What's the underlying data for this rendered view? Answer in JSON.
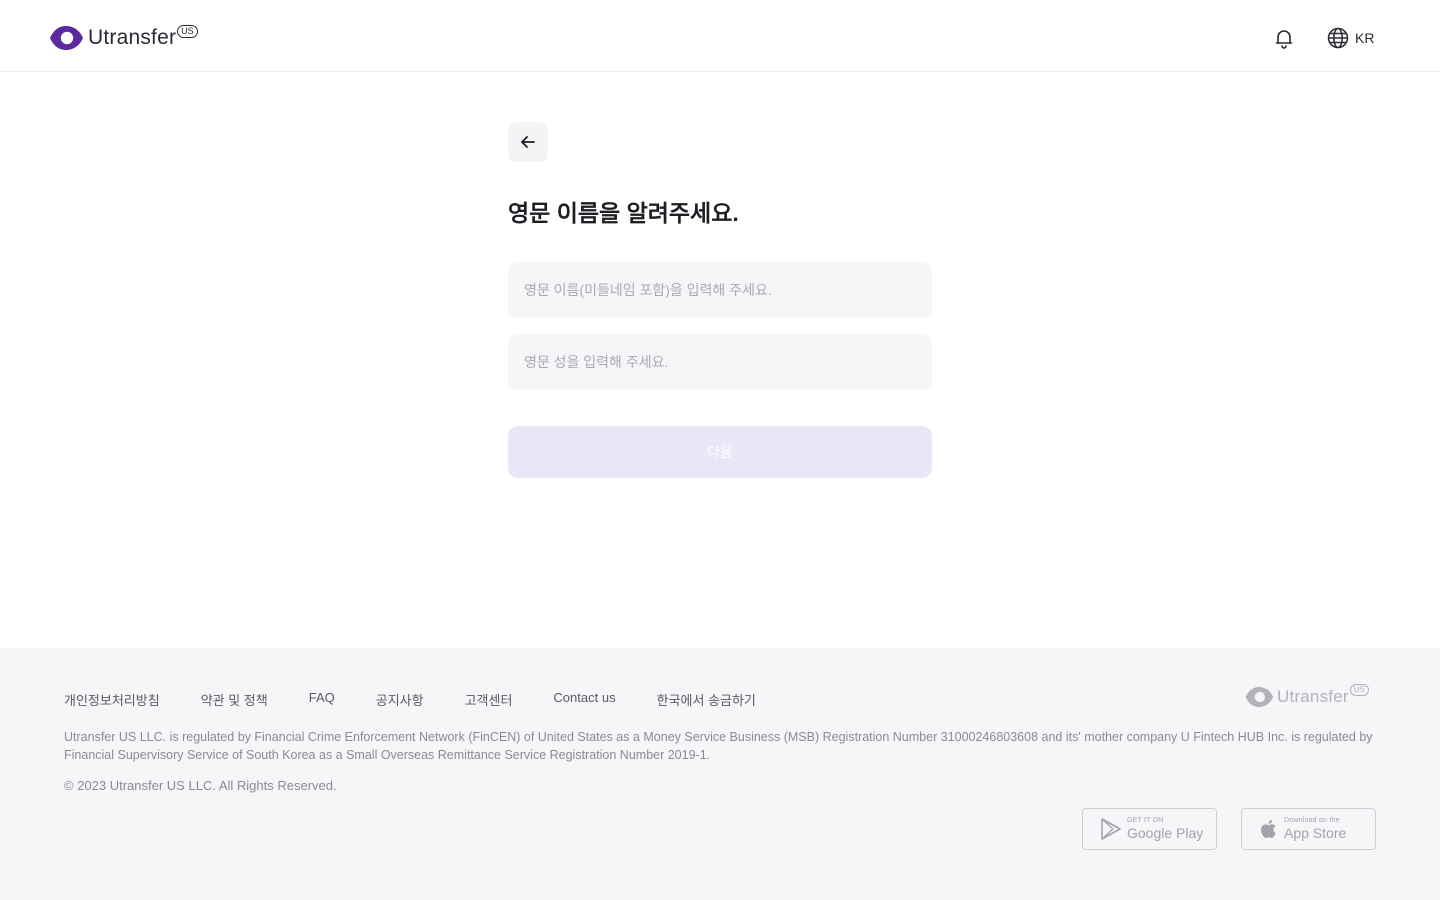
{
  "header": {
    "logo_text": "Utransfer",
    "logo_badge": "US",
    "language": "KR"
  },
  "form": {
    "title": "영문 이름을 알려주세요.",
    "first_name_placeholder": "영문 이름(미들네임 포함)을 입력해 주세요.",
    "first_name_value": "",
    "last_name_placeholder": "영문 성을 입력해 주세요.",
    "last_name_value": "",
    "next_label": "다음"
  },
  "footer": {
    "links": [
      "개인정보처리방침",
      "약관 및 정책",
      "FAQ",
      "공지사항",
      "고객센터",
      "Contact us",
      "한국에서 송금하기"
    ],
    "logo_text": "Utransfer",
    "logo_badge": "US",
    "legal": "Utransfer US LLC. is regulated by Financial Crime Enforcement Network (FinCEN) of United States as a Money Service Business (MSB) Registration Number 31000246803608 and its' mother company U Fintech HUB Inc. is regulated by Financial Supervisory Service of South Korea as a Small Overseas Remittance Service Registration Number 2019-1.",
    "copyright": "© 2023 Utransfer US LLC. All Rights Reserved.",
    "google_play": {
      "small": "GET IT ON",
      "big": "Google Play"
    },
    "app_store": {
      "small": "Download on the",
      "big": "App Store"
    }
  },
  "colors": {
    "brand": "#5b2a9e",
    "button_disabled": "#eae6f7",
    "input_bg": "#f6f6f8",
    "footer_bg": "#f6f6f8"
  },
  "icons": {
    "back": "arrow-left-icon",
    "bell": "bell-icon",
    "language": "globe-icon"
  }
}
